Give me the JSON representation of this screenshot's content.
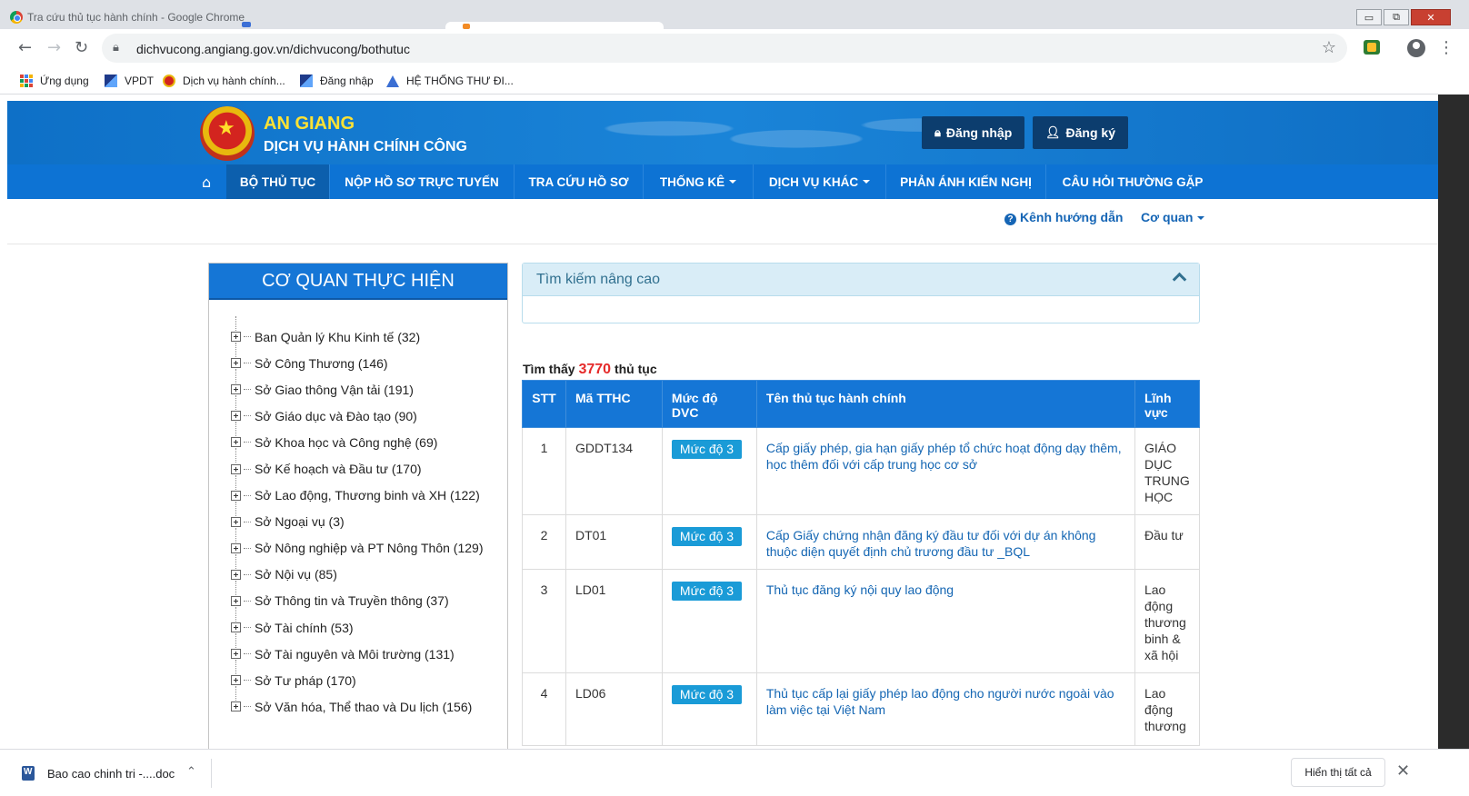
{
  "browser": {
    "tab_title": "Tra cứu thủ tục hành chính - Google Chrome",
    "url": "dichvucong.angiang.gov.vn/dichvucong/bothutuc",
    "window_buttons": [
      "▭",
      "⧉",
      "✕"
    ],
    "bookmarks": [
      {
        "label": "Ứng dụng",
        "icon": "apps-grid-icon"
      },
      {
        "label": "VPDT",
        "icon": "pen-icon"
      },
      {
        "label": "Dịch vụ hành chính...",
        "icon": "emblem-icon"
      },
      {
        "label": "Đăng nhập",
        "icon": "pen-icon"
      },
      {
        "label": "HỆ THỐNG THƯ ĐI...",
        "icon": "triangle-icon"
      }
    ]
  },
  "header": {
    "brand_line1": "AN GIANG",
    "brand_line2": "DỊCH VỤ HÀNH CHÍNH CÔNG",
    "login_label": "Đăng nhập",
    "register_label": "Đăng ký",
    "colors": {
      "brand_yellow": "#ffe233",
      "header_blue": "#1a84d8",
      "nav_blue": "#0d73d4",
      "nav_active": "#0c5fad"
    }
  },
  "nav": {
    "items": [
      {
        "label": "BỘ THỦ TỤC",
        "active": true,
        "dropdown": false
      },
      {
        "label": "NỘP HỒ SƠ TRỰC TUYẾN",
        "active": false,
        "dropdown": false
      },
      {
        "label": "TRA CỨU HỒ SƠ",
        "active": false,
        "dropdown": false
      },
      {
        "label": "THỐNG KÊ",
        "active": false,
        "dropdown": true
      },
      {
        "label": "DỊCH VỤ KHÁC",
        "active": false,
        "dropdown": true
      },
      {
        "label": "PHẢN ÁNH KIẾN NGHỊ",
        "active": false,
        "dropdown": false
      },
      {
        "label": "CÂU HỎI THƯỜNG GẶP",
        "active": false,
        "dropdown": false
      }
    ]
  },
  "subbar": {
    "guide_label": "Kênh hướng dẫn",
    "agency_label": "Cơ quan"
  },
  "left_panel": {
    "title": "CƠ QUAN THỰC HIỆN",
    "items": [
      "Ban Quản lý Khu Kinh tế (32)",
      "Sở Công Thương (146)",
      "Sở Giao thông Vận tải (191)",
      "Sở Giáo dục và Đào tạo (90)",
      "Sở Khoa học và Công nghệ (69)",
      "Sở Kế hoạch và Đầu tư (170)",
      "Sở Lao động, Thương binh và XH (122)",
      "Sở Ngoại vụ (3)",
      "Sở Nông nghiệp và PT Nông Thôn (129)",
      "Sở Nội vụ (85)",
      "Sở Thông tin và Truyền thông (37)",
      "Sở Tài chính (53)",
      "Sở Tài nguyên và Môi trường (131)",
      "Sở Tư pháp (170)",
      "Sở Văn hóa, Thể thao và Du lịch (156)"
    ]
  },
  "search": {
    "title": "Tìm kiếm nâng cao"
  },
  "results": {
    "prefix": "Tìm thấy",
    "count": "3770",
    "suffix": "thủ tục",
    "columns": [
      "STT",
      "Mã TTHC",
      "Mức độ DVC",
      "Tên thủ tục hành chính",
      "Lĩnh vực"
    ],
    "rows": [
      {
        "stt": "1",
        "code": "GDDT134",
        "level": "Mức độ 3",
        "name": "Cấp giấy phép, gia hạn giấy phép tổ chức hoạt động dạy thêm, học thêm đối với cấp trung học cơ sở",
        "field": "GIÁO DỤC TRUNG HỌC"
      },
      {
        "stt": "2",
        "code": "DT01",
        "level": "Mức độ 3",
        "name": "Cấp Giấy chứng nhận đăng ký đầu tư đối với dự án không thuộc diện quyết định chủ trương đầu tư _BQL",
        "field": "Đầu tư"
      },
      {
        "stt": "3",
        "code": "LD01",
        "level": "Mức độ 3",
        "name": "Thủ tục đăng ký nội quy lao động",
        "field": "Lao động thương binh & xã hội"
      },
      {
        "stt": "4",
        "code": "LD06",
        "level": "Mức độ 3",
        "name": "Thủ tục cấp lại giấy phép lao động cho người nước ngoài vào làm việc tại Việt Nam",
        "field": "Lao động thương"
      }
    ]
  },
  "downloads": {
    "file_name": "Bao cao chinh tri -....doc",
    "show_all_label": "Hiển thị tất cả"
  }
}
